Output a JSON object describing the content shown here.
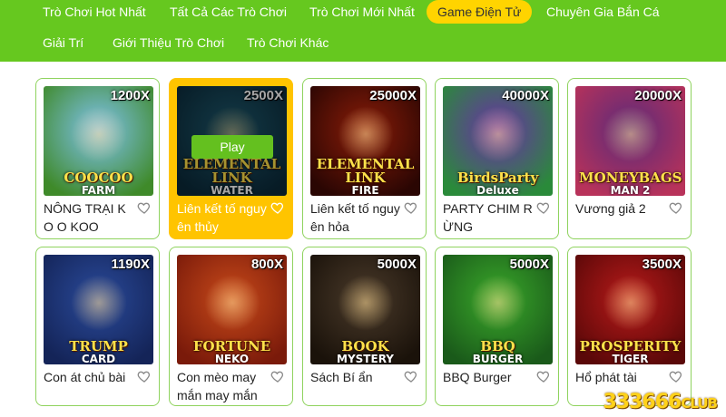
{
  "nav": {
    "items": [
      {
        "label": "Trò Chơi Hot Nhất",
        "active": false
      },
      {
        "label": "Tất Cả Các Trò Chơi",
        "active": false
      },
      {
        "label": "Trò Chơi Mới Nhất",
        "active": false
      },
      {
        "label": "Game Điện Tử",
        "active": true
      },
      {
        "label": "Chuyên Gia Bắn Cá",
        "active": false
      },
      {
        "label": "Giải Trí",
        "active": false
      },
      {
        "label": "Giới Thiệu Trò Chơi",
        "active": false
      },
      {
        "label": "Trò Chơi Khác",
        "active": false
      }
    ]
  },
  "colors": {
    "nav_bg": "#66c81f",
    "active_pill": "#ffd400",
    "card_border": "#8fd35e",
    "highlight_card": "#ffc400",
    "play_button": "#64c01f"
  },
  "play_label": "Play",
  "games": [
    {
      "title": "NÔNG TRẠI KO O KOO",
      "multiplier": "1200X",
      "logo": "COOCOO",
      "logo_sub": "FARM",
      "bg": [
        "#7fc2ee",
        "#3f8a2a"
      ]
    },
    {
      "title": "Liên kết tố nguyên thủy",
      "multiplier": "2500X",
      "logo": "ELEMENTAL LINK",
      "logo_sub": "WATER",
      "bg": [
        "#1e5a6e",
        "#0b2a3a"
      ],
      "highlighted": true
    },
    {
      "title": "Liên kết tố nguyên hỏa",
      "multiplier": "25000X",
      "logo": "ELEMENTAL LINK",
      "logo_sub": "FIRE",
      "bg": [
        "#8a1c08",
        "#2a0603"
      ]
    },
    {
      "title": "PARTY CHIM RỪNG",
      "multiplier": "40000X",
      "logo": "BirdsParty",
      "logo_sub": "Deluxe",
      "bg": [
        "#6a2fa8",
        "#2a8a3a"
      ]
    },
    {
      "title": "Vương giả 2",
      "multiplier": "20000X",
      "logo": "MONEYBAGS",
      "logo_sub": "MAN 2",
      "bg": [
        "#5a2a7a",
        "#b8325a"
      ]
    },
    {
      "title": "Con át chủ bài",
      "multiplier": "1190X",
      "logo": "TRUMP",
      "logo_sub": "CARD",
      "bg": [
        "#2a4a9a",
        "#142458"
      ]
    },
    {
      "title": "Con mèo may mắn may mắn",
      "multiplier": "800X",
      "logo": "FORTUNE",
      "logo_sub": "NEKO",
      "bg": [
        "#c84a1a",
        "#7a1a0a"
      ]
    },
    {
      "title": "Sách Bí ẩn",
      "multiplier": "5000X",
      "logo": "BOOK",
      "logo_sub": "MYSTERY",
      "bg": [
        "#4a3a2a",
        "#1a120a"
      ]
    },
    {
      "title": "BBQ Burger",
      "multiplier": "5000X",
      "logo": "BBQ",
      "logo_sub": "BURGER",
      "bg": [
        "#3aa82a",
        "#1a5a1a"
      ]
    },
    {
      "title": "Hổ phát tài",
      "multiplier": "3500X",
      "logo": "PROSPERITY",
      "logo_sub": "TIGER",
      "bg": [
        "#b81a1a",
        "#5a0808"
      ]
    }
  ],
  "watermark": {
    "main": "333666",
    "suffix": "CLUB"
  }
}
